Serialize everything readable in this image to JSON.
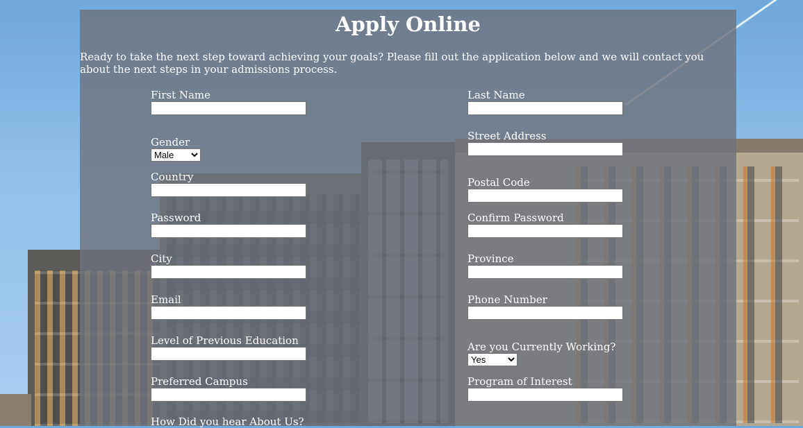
{
  "page": {
    "title": "Apply Online",
    "intro": "Ready to take the next step toward achieving your goals? Please fill out the application below and we will contact you about the next steps in your admissions process."
  },
  "form": {
    "first_name": {
      "label": "First Name",
      "value": ""
    },
    "last_name": {
      "label": "Last Name",
      "value": ""
    },
    "gender": {
      "label": "Gender",
      "selected": "Male"
    },
    "street_address": {
      "label": "Street Address",
      "value": ""
    },
    "country": {
      "label": "Country",
      "value": ""
    },
    "postal_code": {
      "label": "Postal Code",
      "value": ""
    },
    "password": {
      "label": "Password",
      "value": ""
    },
    "confirm_password": {
      "label": "Confirm Password",
      "value": ""
    },
    "city": {
      "label": "City",
      "value": ""
    },
    "province": {
      "label": "Province",
      "value": ""
    },
    "email": {
      "label": "Email",
      "value": ""
    },
    "phone_number": {
      "label": "Phone Number",
      "value": ""
    },
    "previous_education": {
      "label": "Level of Previous Education",
      "value": ""
    },
    "currently_working": {
      "label": "Are you Currently Working?",
      "selected": "Yes"
    },
    "preferred_campus": {
      "label": "Preferred Campus",
      "value": ""
    },
    "program_of_interest": {
      "label": "Program of Interest",
      "value": ""
    },
    "how_heard": {
      "label": "How Did you hear About Us?"
    }
  }
}
